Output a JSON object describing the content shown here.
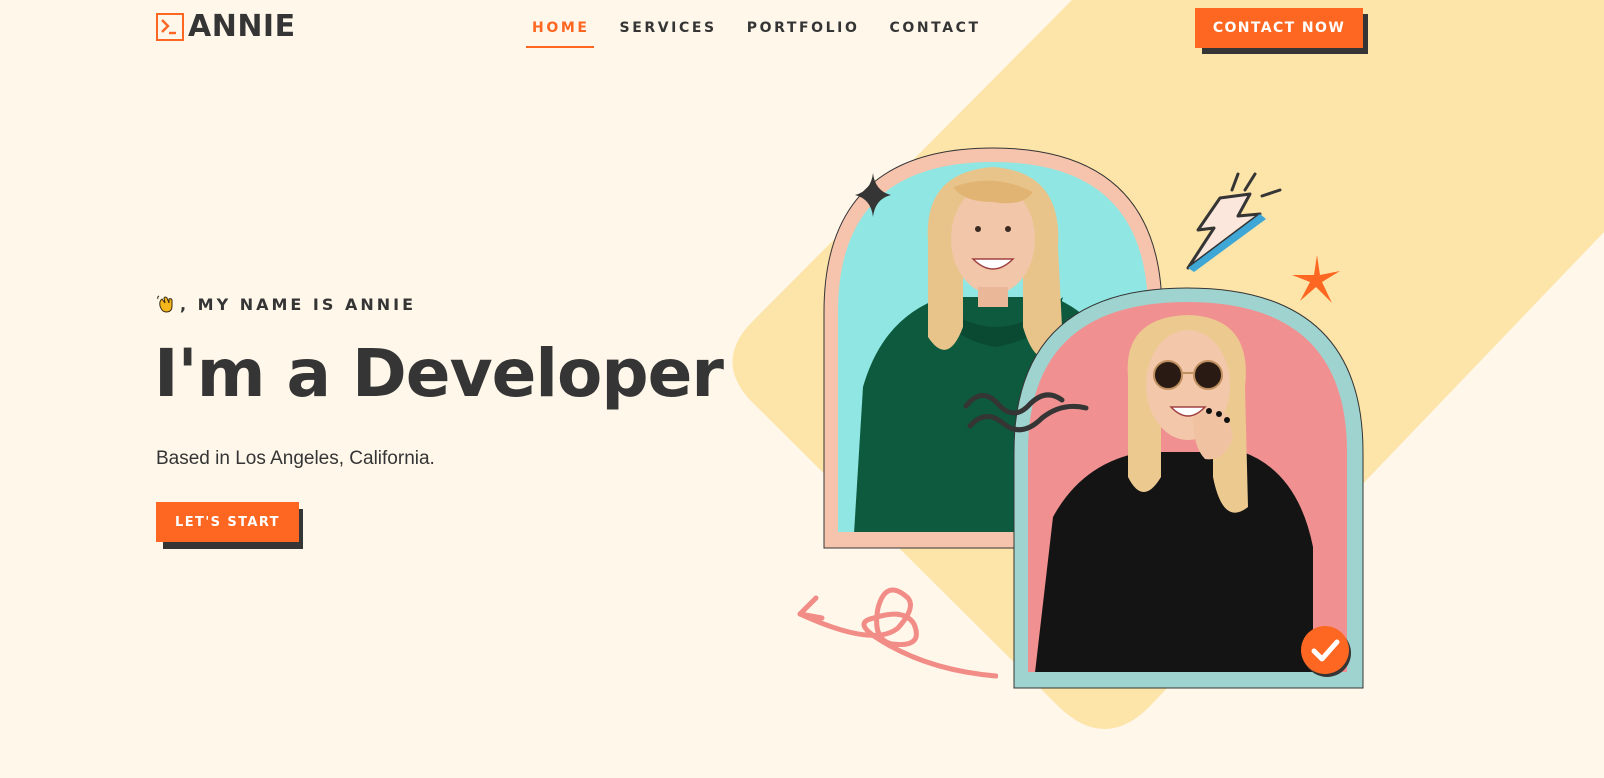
{
  "header": {
    "logo_text": "ANNIE",
    "logo_icon": "terminal-icon",
    "nav": [
      {
        "label": "HOME",
        "active": true
      },
      {
        "label": "SERVICES",
        "active": false
      },
      {
        "label": "PORTFOLIO",
        "active": false
      },
      {
        "label": "CONTACT",
        "active": false
      }
    ],
    "cta_label": "CONTACT NOW"
  },
  "hero": {
    "intro_icon": "waving-hand-icon",
    "intro_text": ", MY NAME IS ANNIE",
    "headline": "I'm a Developer",
    "subline": "Based in Los Angeles, California.",
    "start_label": "LET'S START"
  },
  "photos": [
    {
      "name": "photo-woman-green-hoodie",
      "frame_color": "#f6c4ad",
      "bg_color": "#8fe6e3",
      "clothing": "green-hoodie"
    },
    {
      "name": "photo-woman-sunglasses",
      "frame_color": "#9fd3cf",
      "bg_color": "#f09090",
      "clothing": "black-sweater"
    }
  ],
  "decorations": [
    "sparkle-icon",
    "lightning-icon",
    "star-burst-icon",
    "squiggle-icon",
    "arrow-loop-icon",
    "check-badge-icon"
  ],
  "colors": {
    "accent": "#fd6721",
    "background": "#fef7ea",
    "diamond": "#fde4a8",
    "text": "#353535"
  }
}
